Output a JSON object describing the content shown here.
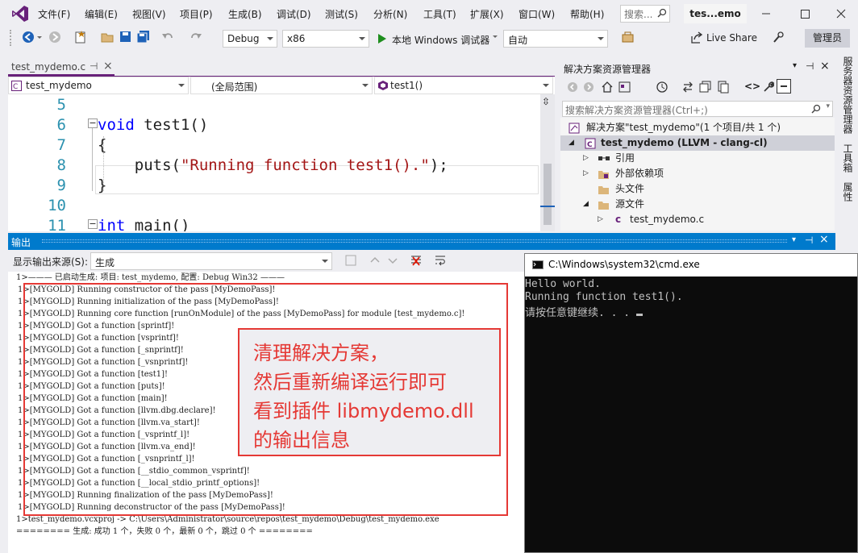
{
  "menubar": {
    "items": [
      "文件(F)",
      "编辑(E)",
      "视图(V)",
      "项目(P)",
      "生成(B)",
      "调试(D)",
      "测试(S)",
      "分析(N)",
      "工具(T)",
      "扩展(X)",
      "窗口(W)",
      "帮助(H)"
    ],
    "search_placeholder": "搜索...",
    "title": "tes...emo"
  },
  "toolbar": {
    "config": "Debug",
    "platform": "x86",
    "run_label": "本地 Windows 调试器",
    "auto_label": "自动",
    "live_share": "Live Share",
    "manage": "管理员",
    "colors": {
      "run": "#1e8e1e",
      "accent": "#68217a"
    }
  },
  "editor": {
    "tab_name": "test_mydemo.c",
    "pin": "⊣",
    "close": "×",
    "project_combo": "test_mydemo",
    "scope_combo": "(全局范围)",
    "func_combo": "test1()",
    "lines": [
      {
        "num": "5",
        "code": ""
      },
      {
        "num": "6",
        "kw": "void",
        "rest": " test1()"
      },
      {
        "num": "7",
        "code": "{"
      },
      {
        "num": "8",
        "pre": "    puts(",
        "str": "\"Running function test1().\"",
        "post": ");"
      },
      {
        "num": "9",
        "code": "}"
      },
      {
        "num": "10",
        "code": ""
      },
      {
        "num": "11",
        "kw": "int",
        "rest": " main()"
      }
    ]
  },
  "solution_explorer": {
    "title": "解决方案资源管理器",
    "search_placeholder": "搜索解决方案资源管理器(Ctrl+;)",
    "items": [
      {
        "label": "解决方案\"test_mydemo\"(1 个项目/共 1 个)"
      },
      {
        "label": "test_mydemo (LLVM - clang-cl)"
      },
      {
        "label": "引用"
      },
      {
        "label": "外部依赖项"
      },
      {
        "label": "头文件"
      },
      {
        "label": "源文件"
      },
      {
        "label": "test_mydemo.c"
      }
    ]
  },
  "side_tabs": [
    "服务器资源管理器",
    "工具箱",
    "属性"
  ],
  "output": {
    "title": "输出",
    "source_label": "显示输出来源(S):",
    "source_value": "生成",
    "lines": [
      "1>——— 已启动生成: 项目: test_mydemo, 配置: Debug Win32 ———",
      "1>[MYGOLD] Running constructor of the pass [MyDemoPass]!",
      "1>[MYGOLD] Running initialization of the pass [MyDemoPass]!",
      "1>[MYGOLD] Running core function [runOnModule] of the pass [MyDemoPass] for module [test_mydemo.c]!",
      "1>[MYGOLD] Got a function [sprintf]!",
      "1>[MYGOLD] Got a function [vsprintf]!",
      "1>[MYGOLD] Got a function [_snprintf]!",
      "1>[MYGOLD] Got a function [_vsnprintf]!",
      "1>[MYGOLD] Got a function [test1]!",
      "1>[MYGOLD] Got a function [puts]!",
      "1>[MYGOLD] Got a function [main]!",
      "1>[MYGOLD] Got a function [llvm.dbg.declare]!",
      "1>[MYGOLD] Got a function [llvm.va_start]!",
      "1>[MYGOLD] Got a function [_vsprintf_l]!",
      "1>[MYGOLD] Got a function [llvm.va_end]!",
      "1>[MYGOLD] Got a function [_vsnprintf_l]!",
      "1>[MYGOLD] Got a function [__stdio_common_vsprintf]!",
      "1>[MYGOLD] Got a function [__local_stdio_printf_options]!",
      "1>[MYGOLD] Running finalization of the pass [MyDemoPass]!",
      "1>[MYGOLD] Running deconstructor of the pass [MyDemoPass]!",
      "1>test_mydemo.vcxproj -> C:\\Users\\Administrator\\source\\repos\\test_mydemo\\Debug\\test_mydemo.exe",
      "======== 生成: 成功 1 个，失败 0 个，最新 0 个，跳过 0 个 ========"
    ],
    "annotation": "清理解决方案，\n然后重新编译运行即可\n看到插件 libmydemo.dll\n的输出信息",
    "annotation_color": "#e53935"
  },
  "cmd": {
    "title": "C:\\Windows\\system32\\cmd.exe",
    "lines": [
      "Hello world.",
      "Running function test1().",
      "请按任意键继续. . . "
    ]
  }
}
